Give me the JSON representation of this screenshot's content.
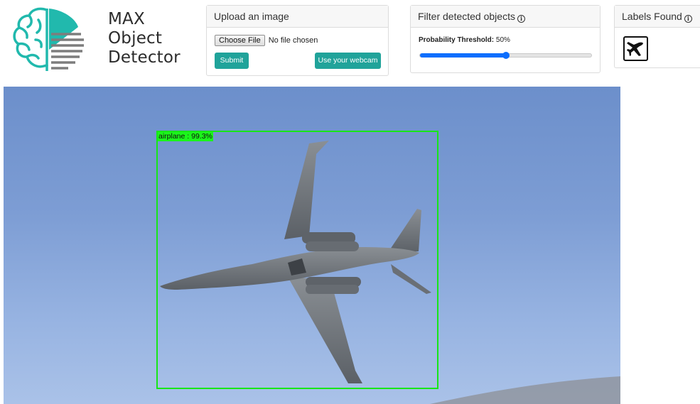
{
  "brand": {
    "line1": "MAX",
    "line2": "Object",
    "line3": "Detector",
    "accent_color": "#21b9ad"
  },
  "upload": {
    "title": "Upload an image",
    "choose_file_label": "Choose File",
    "file_status": "No file chosen",
    "submit_label": "Submit",
    "webcam_label": "Use your webcam",
    "button_color": "#20a39a"
  },
  "filter": {
    "title": "Filter detected objects",
    "threshold_label": "Probability Threshold:",
    "threshold_value": "50%",
    "threshold_level": 0.5,
    "slider_color": "#0d6efd"
  },
  "labels": {
    "title": "Labels Found",
    "icons": [
      "airplane-icon"
    ]
  },
  "detection": {
    "label": "airplane : 99.3%",
    "box_color": "#17e617"
  }
}
